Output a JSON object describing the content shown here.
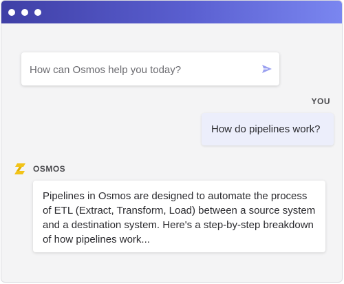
{
  "window": {
    "dots": [
      "close",
      "minimize",
      "maximize"
    ]
  },
  "search": {
    "placeholder": "How can Osmos help you today?",
    "value": "",
    "send_icon": "send-icon"
  },
  "conversation": {
    "user": {
      "label": "YOU",
      "message": "How do pipelines work?"
    },
    "assistant": {
      "name": "OSMOS",
      "logo_icon": "osmos-logo-icon",
      "message": "Pipelines in Osmos are designed to automate the process of ETL (Extract, Transform, Load) between a source system and a destination system. Here's a step-by-step breakdown of how pipelines work..."
    }
  },
  "colors": {
    "titlebar_start": "#3f3fa6",
    "titlebar_end": "#7a86f0",
    "send_accent": "#9aa0f0",
    "user_bubble": "#eceefb",
    "logo_yellow": "#f2c318"
  }
}
